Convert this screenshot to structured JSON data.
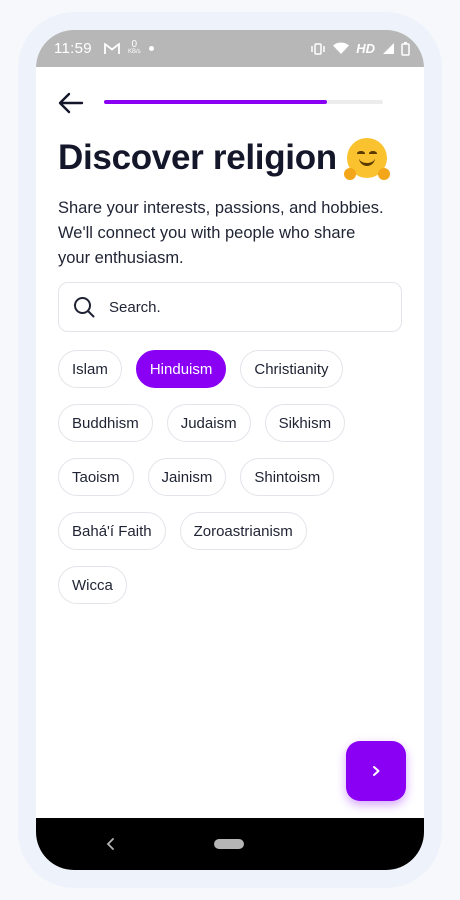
{
  "status_bar": {
    "time": "11:59",
    "network_speed_value": "0",
    "network_speed_unit": "KB/s",
    "network_type": "HD",
    "icons": [
      "gmail-icon",
      "dot-icon",
      "vibrate-icon",
      "wifi-icon",
      "signal-icon",
      "battery-icon"
    ]
  },
  "header": {
    "progress": 0.8,
    "back_icon": "arrow-left-icon"
  },
  "title": "Discover religion",
  "title_emoji": "hugging-face-emoji",
  "subtitle": "Share your interests, passions, and hobbies. We'll connect you with people who share your enthusiasm.",
  "search": {
    "placeholder": "Search.",
    "value": "",
    "icon": "search-icon"
  },
  "chips": [
    [
      "Islam",
      "Hinduism",
      "Christianity"
    ],
    [
      "Buddhism",
      "Judaism",
      "Sikhism"
    ],
    [
      "Taoism",
      "Jainism",
      "Shintoism"
    ],
    [
      "Bahá'í Faith",
      "Zoroastrianism"
    ],
    [
      "Wicca"
    ]
  ],
  "selected_chip": "Hinduism",
  "next_button": {
    "icon": "chevron-right-icon"
  },
  "colors": {
    "accent": "#8a00f5",
    "text_dark": "#14162a",
    "chip_border": "#e3e4ea",
    "status_bar_bg": "#b7b7b7",
    "nav_bar_bg": "#000000"
  }
}
